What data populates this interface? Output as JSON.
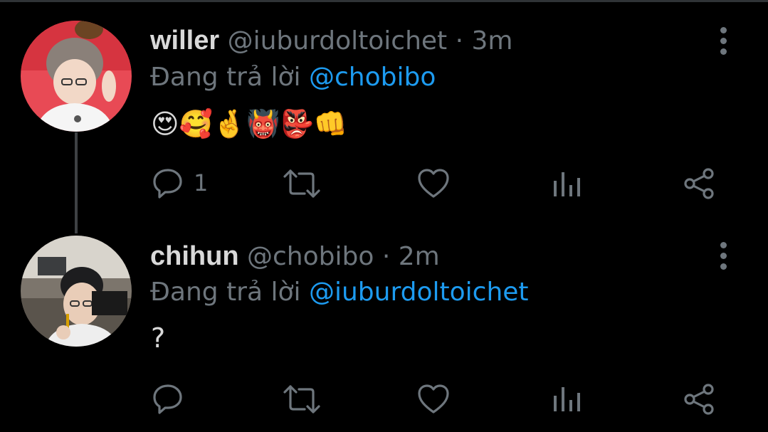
{
  "tweets": [
    {
      "display_name": "willer",
      "handle": "@iuburdoltoichet",
      "time": "· 3m",
      "replying_prefix": "Đang trả lời",
      "replying_to": "@chobibo",
      "body": "😍🥰🤞👹👺👊",
      "reply_count": "1",
      "avatar_icon": "person-avatar",
      "actions": [
        "reply-icon",
        "retweet-icon",
        "like-icon",
        "analytics-icon",
        "share-icon"
      ]
    },
    {
      "display_name": "chihun",
      "handle": "@chobibo",
      "time": "· 2m",
      "replying_prefix": "Đang trả lời",
      "replying_to": "@iuburdoltoichet",
      "body": "?",
      "reply_count": "",
      "avatar_icon": "person-avatar",
      "actions": [
        "reply-icon",
        "retweet-icon",
        "like-icon",
        "analytics-icon",
        "share-icon"
      ]
    }
  ],
  "colors": {
    "background": "#000000",
    "name": "#d9d9d9",
    "secondary": "#6e767d",
    "mention": "#1d9bf0",
    "thread_line": "#3e4144"
  }
}
